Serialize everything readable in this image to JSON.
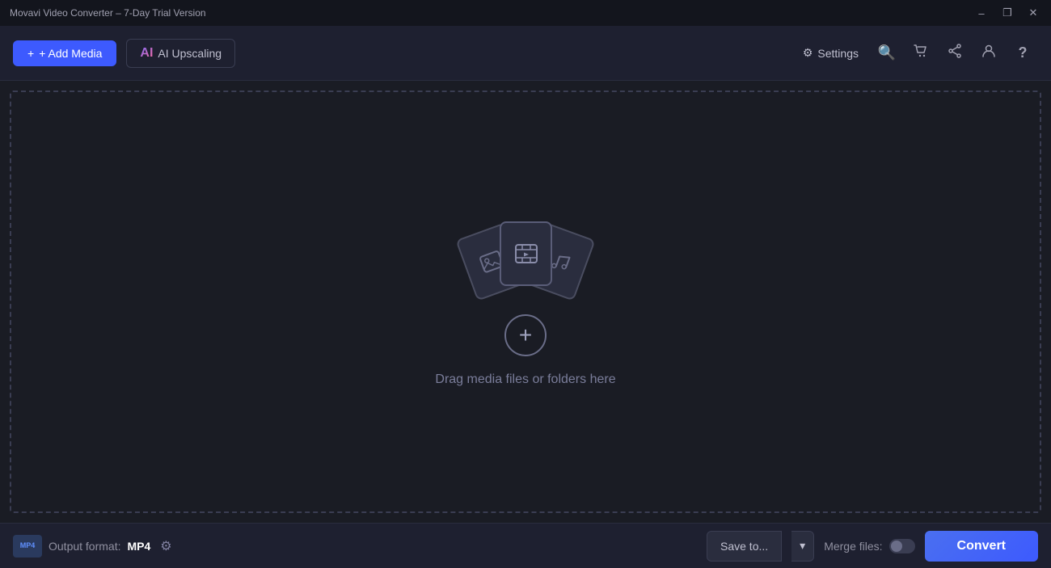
{
  "titleBar": {
    "title": "Movavi Video Converter – 7-Day Trial Version",
    "controls": {
      "minimize": "–",
      "maximize": "❐",
      "close": "✕"
    }
  },
  "toolbar": {
    "addMediaLabel": "+ Add Media",
    "aiUpscalingLabel": "AI Upscaling",
    "settingsLabel": "Settings",
    "icons": {
      "search": "🔍",
      "cart": "🛒",
      "share": "⇧",
      "account": "👤",
      "help": "?"
    }
  },
  "dropZone": {
    "dragText": "Drag media files or folders here",
    "addIcon": "+"
  },
  "bottomBar": {
    "outputFormatLabel": "Output format:",
    "outputFormatBadge": "MP4",
    "outputFormatValue": "MP4",
    "saveToLabel": "Save to...",
    "mergeFilesLabel": "Merge files:",
    "convertLabel": "Convert"
  }
}
